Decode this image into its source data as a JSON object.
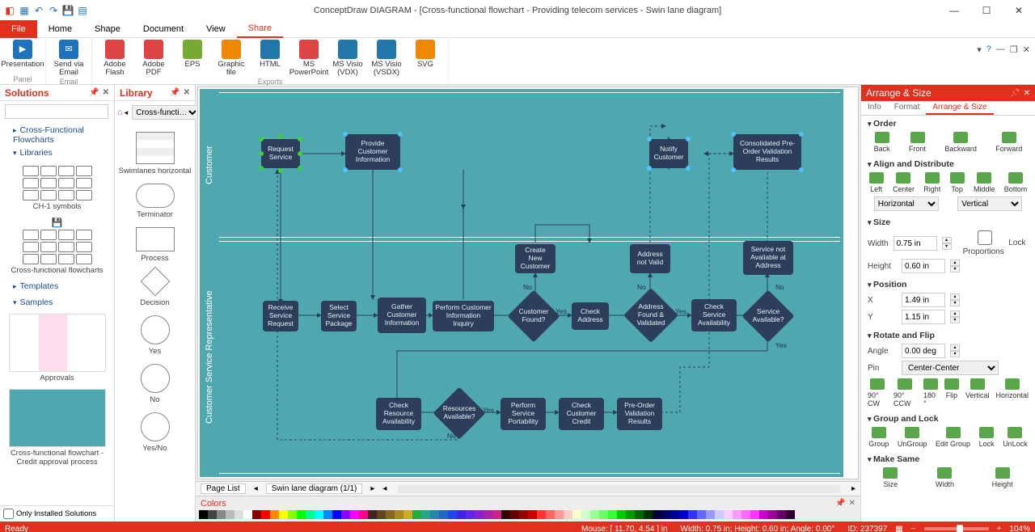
{
  "app_title": "ConceptDraw DIAGRAM - [Cross-functional flowchart - Providing telecom services - Swin lane diagram]",
  "qat": [
    "dropdown",
    "new",
    "undo",
    "redo",
    "save",
    "open"
  ],
  "menu": {
    "file": "File",
    "tabs": [
      "Home",
      "Shape",
      "Document",
      "View",
      "Share"
    ],
    "active": "Share"
  },
  "ribbon": {
    "groups": [
      {
        "label": "Panel",
        "items": [
          {
            "icon": "#1e73be",
            "text": "Presentation"
          }
        ]
      },
      {
        "label": "Email",
        "items": [
          {
            "icon": "#1e73be",
            "text": "Send via Email"
          }
        ]
      },
      {
        "label": "Exports",
        "items": [
          {
            "icon": "#d44",
            "text": "Adobe Flash"
          },
          {
            "icon": "#d44",
            "text": "Adobe PDF"
          },
          {
            "icon": "#7a3",
            "text": "EPS"
          },
          {
            "icon": "#e80",
            "text": "Graphic file"
          },
          {
            "icon": "#27a",
            "text": "HTML"
          },
          {
            "icon": "#d44",
            "text": "MS PowerPoint"
          },
          {
            "icon": "#27a",
            "text": "MS Visio (VDX)"
          },
          {
            "icon": "#27a",
            "text": "MS Visio (VSDX)"
          },
          {
            "icon": "#e80",
            "text": "SVG"
          }
        ]
      }
    ]
  },
  "solutions": {
    "title": "Solutions",
    "tree": {
      "root": "Cross-Functional Flowcharts",
      "libraries": "Libraries",
      "templates": "Templates",
      "samples": "Samples"
    },
    "lib1": "CH-1 symbols",
    "lib2": "Cross-functional flowcharts",
    "sample1": "Approvals",
    "sample2": "Cross-functional flowchart - Credit approval process",
    "only_installed": "Only Installed Solutions"
  },
  "library": {
    "title": "Library",
    "combo": "Cross-functi…",
    "shapes": [
      {
        "cls": "swim",
        "label": "Swimlanes horizontal"
      },
      {
        "cls": "round",
        "label": "Terminator"
      },
      {
        "cls": "",
        "label": "Process"
      },
      {
        "cls": "diamond",
        "label": "Decision"
      },
      {
        "cls": "circle",
        "label": "Yes"
      },
      {
        "cls": "circle",
        "label": "No"
      },
      {
        "cls": "circle",
        "label": "Yes/No"
      }
    ]
  },
  "canvas": {
    "lanes": {
      "customer": "Customer",
      "csr": "Customer Service Representative"
    },
    "nodes": {
      "n1": "Request Service",
      "n2": "Provide Customer Information",
      "n3": "Notify Customer",
      "n4": "Consolidated Pre-Order Validation Results",
      "n5": "Receive Service Request",
      "n6": "Select Service Package",
      "n7": "Gather Customer Information",
      "n8": "Perform Customer Information Inquiry",
      "n9": "Customer Found?",
      "n10": "Create New Customer",
      "n11": "Check Address",
      "n12": "Address not Valid",
      "n13": "Address Found & Validated",
      "n14": "Check Service Availability",
      "n15": "Service not Available at Address",
      "n16": "Service Available?",
      "n17": "Check Resource Availability",
      "n18": "Resources Available?",
      "n19": "Perform Service Portability",
      "n20": "Check Customer Credit",
      "n21": "Pre-Order Validation Results"
    },
    "edge_labels": {
      "yes": "Yes",
      "no": "No"
    }
  },
  "page_tabs": {
    "pagelist": "Page List",
    "current": "Swin lane diagram (1/1)"
  },
  "colors_title": "Colors",
  "color_palette": [
    "#000",
    "#444",
    "#888",
    "#bbb",
    "#ddd",
    "#fff",
    "#800",
    "#f00",
    "#f80",
    "#ff0",
    "#8f0",
    "#0f0",
    "#0f8",
    "#0ff",
    "#08f",
    "#00f",
    "#80f",
    "#f0f",
    "#f08",
    "#422",
    "#642",
    "#862",
    "#a82",
    "#ca2",
    "#2a4",
    "#2a8",
    "#28a",
    "#26c",
    "#24e",
    "#42e",
    "#62e",
    "#82c",
    "#a2a",
    "#c28",
    "#300",
    "#600",
    "#900",
    "#c00",
    "#f33",
    "#f66",
    "#f99",
    "#fcc",
    "#ffc",
    "#cfc",
    "#9f9",
    "#6f6",
    "#3f3",
    "#0c0",
    "#090",
    "#060",
    "#030",
    "#003",
    "#006",
    "#009",
    "#00c",
    "#33f",
    "#66f",
    "#99f",
    "#ccf",
    "#fcf",
    "#f9f",
    "#f6f",
    "#f3f",
    "#c0c",
    "#909",
    "#606",
    "#303"
  ],
  "arrange": {
    "title": "Arrange & Size",
    "tabs": [
      "Info",
      "Format",
      "Arrange & Size"
    ],
    "active_tab": "Arrange & Size",
    "order": {
      "title": "Order",
      "items": [
        "Back",
        "Front",
        "Backward",
        "Forward"
      ]
    },
    "align": {
      "title": "Align and Distribute",
      "items": [
        "Left",
        "Center",
        "Right",
        "Top",
        "Middle",
        "Bottom"
      ],
      "h": "Horizontal",
      "v": "Vertical"
    },
    "size": {
      "title": "Size",
      "width_label": "Width",
      "width": "0.75 in",
      "height_label": "Height",
      "height": "0.60 in",
      "lock": "Lock Proportions"
    },
    "position": {
      "title": "Position",
      "x_label": "X",
      "x": "1.49 in",
      "y_label": "Y",
      "y": "1.15 in"
    },
    "rotate": {
      "title": "Rotate and Flip",
      "angle_label": "Angle",
      "angle": "0.00 deg",
      "pin_label": "Pin",
      "pin": "Center-Center",
      "items": [
        "90° CW",
        "90° CCW",
        "180 °",
        "Flip",
        "Vertical",
        "Horizontal"
      ]
    },
    "group": {
      "title": "Group and Lock",
      "items": [
        "Group",
        "UnGroup",
        "Edit Group",
        "Lock",
        "UnLock"
      ]
    },
    "makesame": {
      "title": "Make Same",
      "items": [
        "Size",
        "Width",
        "Height"
      ]
    }
  },
  "status": {
    "ready": "Ready",
    "mouse": "Mouse: [ 11.70, 4.54 ] in",
    "dims": "Width: 0.75 in; Height: 0.60 in; Angle: 0.00°",
    "id": "ID: 237397",
    "zoom": "104%"
  }
}
